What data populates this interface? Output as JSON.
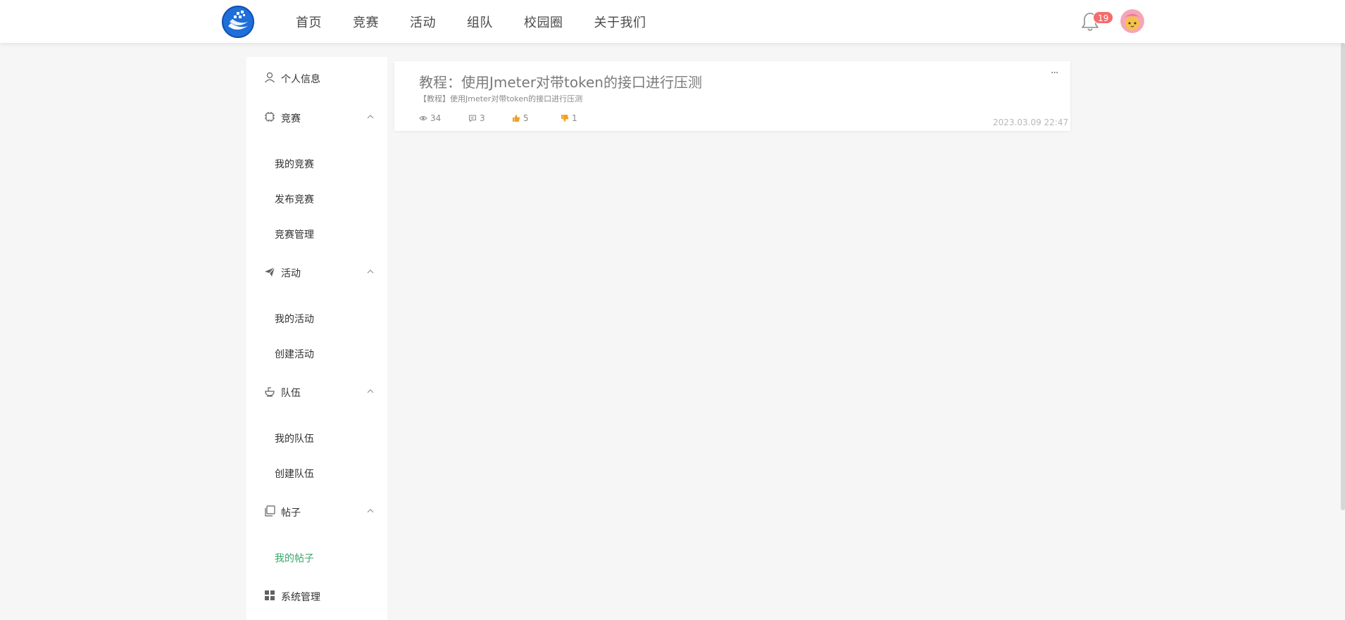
{
  "header": {
    "nav": [
      "首页",
      "竞赛",
      "活动",
      "组队",
      "校园圈",
      "关于我们"
    ],
    "notification_count": "19",
    "accent_color": "#1e6fd9",
    "badge_color": "#f56c6c"
  },
  "sidebar": {
    "profile_label": "个人信息",
    "competition": {
      "label": "竞赛",
      "items": [
        "我的竞赛",
        "发布竞赛",
        "竞赛管理"
      ]
    },
    "activity": {
      "label": "活动",
      "items": [
        "我的活动",
        "创建活动"
      ]
    },
    "team": {
      "label": "队伍",
      "items": [
        "我的队伍",
        "创建队伍"
      ]
    },
    "posts": {
      "label": "帖子",
      "items": [
        "我的帖子"
      ],
      "active_item": "我的帖子"
    },
    "system_label": "系统管理",
    "active_color": "#36a66a"
  },
  "post": {
    "title": "教程：使用Jmeter对带token的接口进行压测",
    "subtitle": "【教程】使用Jmeter对带token的接口进行压测",
    "views": "34",
    "comments": "3",
    "likes": "5",
    "dislikes": "1",
    "date": "2023.03.09 22:47",
    "more_label": "···"
  }
}
